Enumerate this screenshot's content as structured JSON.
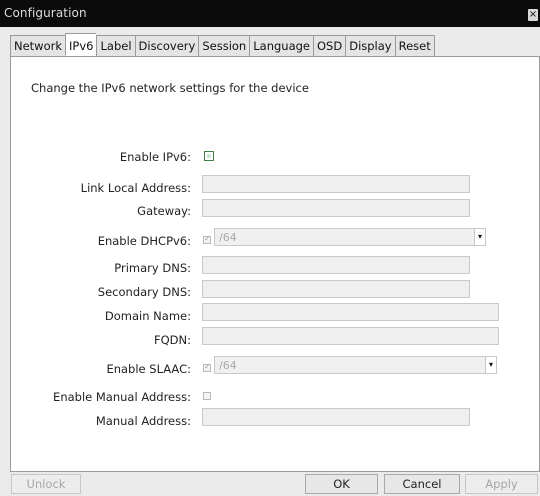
{
  "window": {
    "title": "Configuration",
    "close_glyph": "×"
  },
  "tabs": [
    {
      "label": "Network",
      "active": false
    },
    {
      "label": "IPv6",
      "active": true
    },
    {
      "label": "Label",
      "active": false
    },
    {
      "label": "Discovery",
      "active": false
    },
    {
      "label": "Session",
      "active": false
    },
    {
      "label": "Language",
      "active": false
    },
    {
      "label": "OSD",
      "active": false
    },
    {
      "label": "Display",
      "active": false
    },
    {
      "label": "Reset",
      "active": false
    }
  ],
  "description": "Change the IPv6 network settings for the device",
  "form": {
    "enable_ipv6": {
      "label": "Enable IPv6:",
      "checked": false
    },
    "link_local": {
      "label": "Link Local Address:",
      "value": ""
    },
    "gateway": {
      "label": "Gateway:",
      "value": ""
    },
    "enable_dhcpv6": {
      "label": "Enable DHCPv6:",
      "checked": true,
      "prefix": "/64"
    },
    "primary_dns": {
      "label": "Primary DNS:",
      "value": ""
    },
    "secondary_dns": {
      "label": "Secondary DNS:",
      "value": ""
    },
    "domain_name": {
      "label": "Domain Name:",
      "value": ""
    },
    "fqdn": {
      "label": "FQDN:",
      "value": ""
    },
    "enable_slaac": {
      "label": "Enable SLAAC:",
      "checked": true,
      "prefix": "/64"
    },
    "enable_manual": {
      "label": "Enable Manual Address:",
      "checked": false
    },
    "manual_address": {
      "label": "Manual Address:",
      "value": ""
    }
  },
  "buttons": {
    "unlock": "Unlock",
    "ok": "OK",
    "cancel": "Cancel",
    "apply": "Apply"
  },
  "icons": {
    "dropdown": "▾",
    "close": "close-icon"
  }
}
